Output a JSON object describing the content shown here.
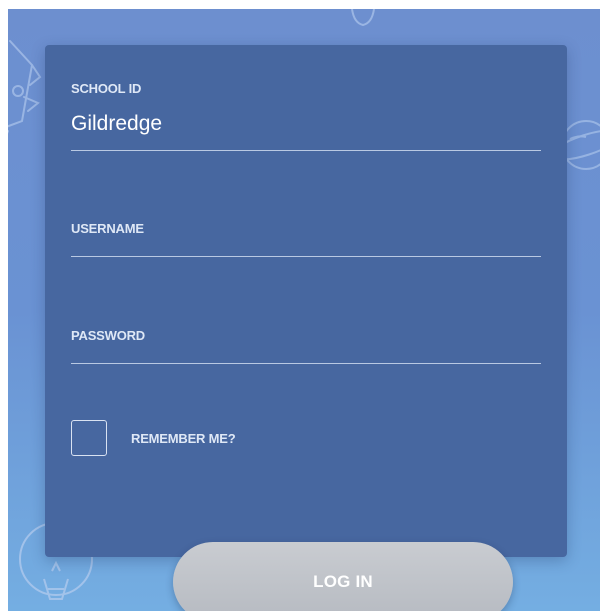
{
  "form": {
    "school_id": {
      "label": "SCHOOL ID",
      "value": "Gildredge"
    },
    "username": {
      "label": "USERNAME",
      "value": ""
    },
    "password": {
      "label": "PASSWORD",
      "value": ""
    },
    "remember_me": {
      "label": "REMEMBER ME?",
      "checked": false
    },
    "login_label": "LOG IN"
  },
  "background": {
    "doodles": [
      "rocket-icon",
      "bulb-icon",
      "planet-icon",
      "lightbulb-icon"
    ]
  },
  "colors": {
    "background_top": "#6d8fcf",
    "background_bottom": "#74aee2",
    "card": "#4767a0",
    "button": "#c0c4ca",
    "text_light": "#dfe8f6"
  }
}
